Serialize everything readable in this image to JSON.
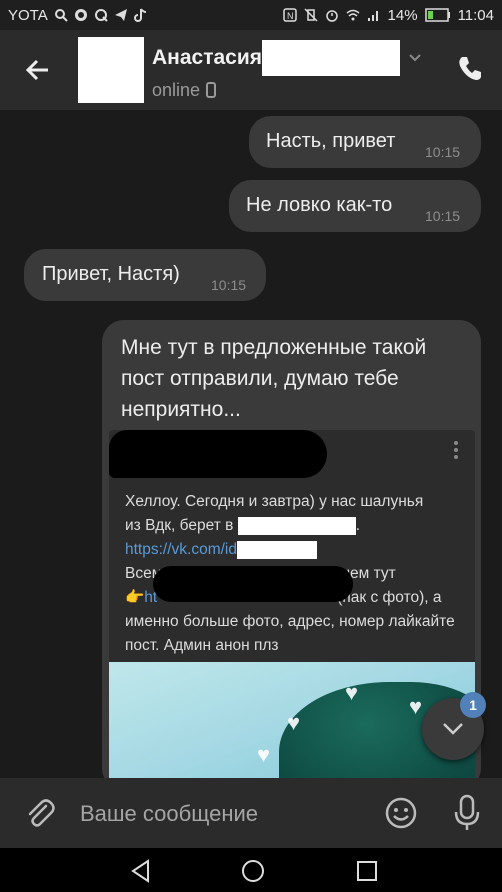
{
  "status_bar": {
    "carrier": "YOTA",
    "battery": "14%",
    "time": "11:04"
  },
  "header": {
    "contact_name": "Анастасия",
    "status": "online"
  },
  "messages": [
    {
      "text": "Насть, привет",
      "time": "10:15",
      "direction": "out"
    },
    {
      "text": "Не ловко как-то",
      "time": "10:15",
      "direction": "out"
    },
    {
      "text": "Привет, Настя)",
      "time": "10:15",
      "direction": "in"
    },
    {
      "text": "Мне тут в предложенные такой пост отправили, думаю тебе неприятно...",
      "direction": "out"
    }
  ],
  "forwarded_post": {
    "line1": "Хеллоу. Сегодня и завтра) у нас шалунья",
    "line2a": "из Вдк, берет в",
    "line2b": ".",
    "link": "https://vk.com/id",
    "line4": "Всем кто хочет больше инфы чем тут",
    "line5a": "👉ht",
    "line5b": "(пак с фото), а",
    "line6": "именно больше фото, адрес, номер лайкайте",
    "line7": "пост. Админ анон плз"
  },
  "scroll_fab": {
    "badge": "1"
  },
  "composer": {
    "placeholder": "Ваше сообщение"
  },
  "colors": {
    "background": "#1b1b1b",
    "bubble": "#3a3a3a",
    "header": "#2b2b2b",
    "accent": "#5181b8",
    "link": "#5a9ad8"
  }
}
